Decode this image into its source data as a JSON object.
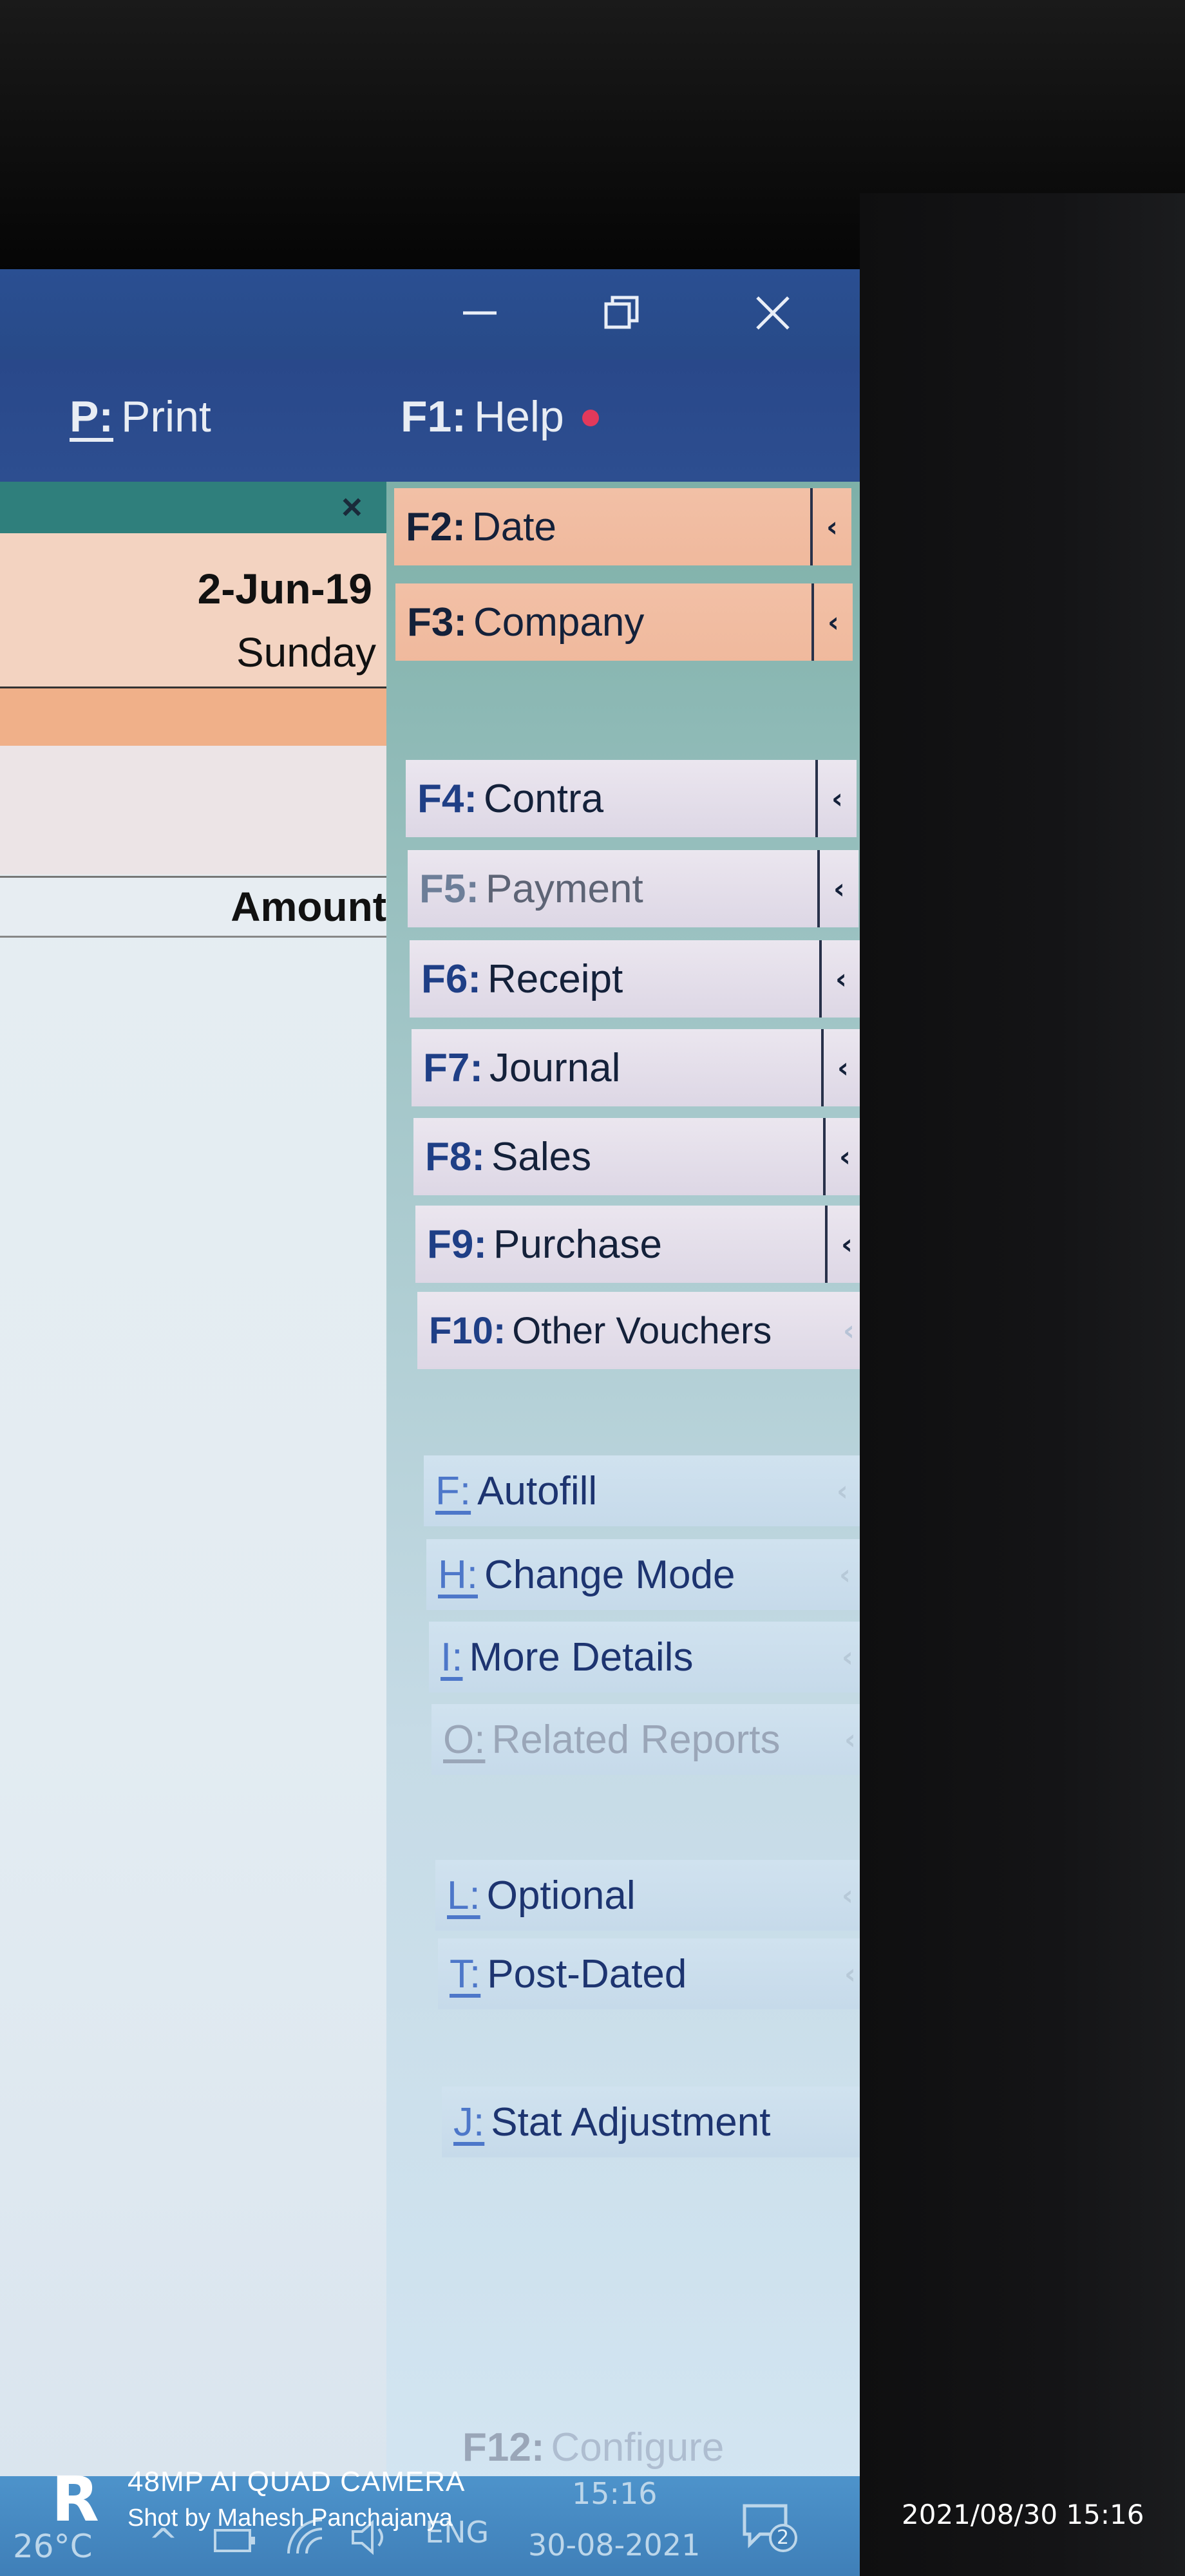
{
  "window": {
    "minimize_icon": "minimize-icon",
    "maximize_icon": "restore-icon",
    "close_icon": "close-icon"
  },
  "menu": {
    "print_key": "P:",
    "print_label": "Print",
    "help_key": "F1:",
    "help_label": "Help"
  },
  "left_panel": {
    "close_glyph": "×",
    "date": "2-Jun-19",
    "day": "Sunday",
    "amount_header": "Amount"
  },
  "buttons": [
    {
      "key": "F2:",
      "label": "Date",
      "arrow": "‹"
    },
    {
      "key": "F3:",
      "label": "Company",
      "arrow": "‹"
    },
    {
      "key": "F4:",
      "label": "Contra",
      "arrow": "‹"
    },
    {
      "key": "F5:",
      "label": "Payment",
      "arrow": "‹"
    },
    {
      "key": "F6:",
      "label": "Receipt",
      "arrow": "‹"
    },
    {
      "key": "F7:",
      "label": "Journal",
      "arrow": "‹"
    },
    {
      "key": "F8:",
      "label": "Sales",
      "arrow": "‹"
    },
    {
      "key": "F9:",
      "label": "Purchase",
      "arrow": "‹"
    },
    {
      "key": "F10:",
      "label": "Other Vouchers",
      "arrow": "‹"
    },
    {
      "key": "F:",
      "label": "Autofill",
      "arrow": "‹"
    },
    {
      "key": "H:",
      "label": "Change Mode",
      "arrow": "‹"
    },
    {
      "key": "I:",
      "label": "More Details",
      "arrow": "‹"
    },
    {
      "key": "O:",
      "label": "Related Reports",
      "arrow": "‹"
    },
    {
      "key": "L:",
      "label": "Optional",
      "arrow": "‹"
    },
    {
      "key": "T:",
      "label": "Post-Dated",
      "arrow": "‹"
    },
    {
      "key": "J:",
      "label": "Stat Adjustment",
      "arrow": ""
    },
    {
      "key": "F12:",
      "label": "Configure",
      "arrow": ""
    }
  ],
  "taskbar": {
    "temperature": "26°C",
    "language": "ENG",
    "time": "15:16",
    "date": "30-08-2021",
    "notification_count": "2"
  },
  "watermark": {
    "logo": "R",
    "line1": "48MP AI QUAD CAMERA",
    "line2": "Shot by Mahesh Panchajanya"
  },
  "photo_timestamp": "2021/08/30 15:16"
}
